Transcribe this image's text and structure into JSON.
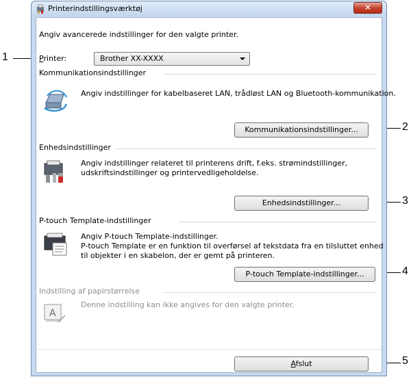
{
  "window": {
    "title": "Printerindstillingsværktøj",
    "close_label": "✕",
    "intro": "Angiv avancerede indstillinger for den valgte printer."
  },
  "printer": {
    "label": "Printer:",
    "selected": "Brother XX-XXXX"
  },
  "sections": {
    "communication": {
      "heading": "Kommunikationsindstillinger",
      "description": "Angiv indstillinger for kabelbaseret LAN, trådløst LAN og Bluetooth-kommunikation.",
      "button": "Kommunikationsindstillinger..."
    },
    "device": {
      "heading": "Enhedsindstillinger",
      "description_line1": "Angiv indstillinger relateret til printerens drift, f.eks. strømindstillinger,",
      "description_line2": "udskriftsindstillinger og printervedligeholdelse.",
      "button": "Enhedsindstillinger..."
    },
    "ptouch": {
      "heading": "P-touch Template-indstillinger",
      "description_line1": "Angiv P-touch Template-indstillinger.",
      "description_line2": "P-touch Template er en funktion til overførsel af tekstdata fra en tilsluttet enhed",
      "description_line3": "til objekter i en skabelon, der er gemt på printeren.",
      "button": "P-touch Template-indstillinger..."
    },
    "paper": {
      "heading": "Indstilling af papirstørrelse",
      "description": "Denne indstilling kan ikke angives for den valgte printer."
    }
  },
  "footer": {
    "exit_button": "Afslut"
  },
  "callouts": [
    "1",
    "2",
    "3",
    "4",
    "5"
  ],
  "colors": {
    "title_gradient_top": "#e0ebf8",
    "close_red": "#c6452f",
    "disabled_text": "#8d8d8d"
  },
  "icons": {
    "app": "printer-tool-icon",
    "communication": "network-printer-icon",
    "device": "printer-tools-icon",
    "ptouch": "template-document-icon",
    "paper": "paper-size-icon"
  }
}
